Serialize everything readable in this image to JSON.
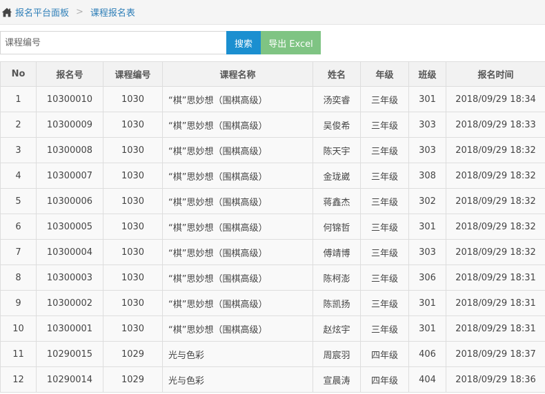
{
  "breadcrumb": {
    "home_icon": "home-icon",
    "items": [
      "报名平台面板",
      "课程报名表"
    ],
    "separator": ">"
  },
  "search": {
    "placeholder": "课程编号",
    "value": "",
    "search_label": "搜索",
    "export_label": "导出 Excel"
  },
  "colors": {
    "link": "#2f7fb8",
    "search_button": "#1b8fd0",
    "export_button": "#7fc483"
  },
  "table": {
    "headers": [
      "No",
      "报名号",
      "课程编号",
      "课程名称",
      "姓名",
      "年级",
      "班级",
      "报名时间"
    ],
    "rows": [
      [
        "1",
        "10300010",
        "1030",
        "“棋”思妙想（围棋高级）",
        "汤奕睿",
        "三年级",
        "301",
        "2018/09/29 18:34"
      ],
      [
        "2",
        "10300009",
        "1030",
        "“棋”思妙想（围棋高级）",
        "吴俊希",
        "三年级",
        "303",
        "2018/09/29 18:33"
      ],
      [
        "3",
        "10300008",
        "1030",
        "“棋”思妙想（围棋高级）",
        "陈天宇",
        "三年级",
        "303",
        "2018/09/29 18:32"
      ],
      [
        "4",
        "10300007",
        "1030",
        "“棋”思妙想（围棋高级）",
        "金珑崴",
        "三年级",
        "308",
        "2018/09/29 18:32"
      ],
      [
        "5",
        "10300006",
        "1030",
        "“棋”思妙想（围棋高级）",
        "蒋鑫杰",
        "三年级",
        "302",
        "2018/09/29 18:32"
      ],
      [
        "6",
        "10300005",
        "1030",
        "“棋”思妙想（围棋高级）",
        "何锦哲",
        "三年级",
        "301",
        "2018/09/29 18:32"
      ],
      [
        "7",
        "10300004",
        "1030",
        "“棋”思妙想（围棋高级）",
        "傅靖博",
        "三年级",
        "303",
        "2018/09/29 18:32"
      ],
      [
        "8",
        "10300003",
        "1030",
        "“棋”思妙想（围棋高级）",
        "陈柯澎",
        "三年级",
        "306",
        "2018/09/29 18:31"
      ],
      [
        "9",
        "10300002",
        "1030",
        "“棋”思妙想（围棋高级）",
        "陈凯扬",
        "三年级",
        "301",
        "2018/09/29 18:31"
      ],
      [
        "10",
        "10300001",
        "1030",
        "“棋”思妙想（围棋高级）",
        "赵炫宇",
        "三年级",
        "301",
        "2018/09/29 18:31"
      ],
      [
        "11",
        "10290015",
        "1029",
        "光与色彩",
        "周宸羽",
        "四年级",
        "406",
        "2018/09/29 18:37"
      ],
      [
        "12",
        "10290014",
        "1029",
        "光与色彩",
        "宣晨涛",
        "四年级",
        "404",
        "2018/09/29 18:36"
      ]
    ]
  }
}
